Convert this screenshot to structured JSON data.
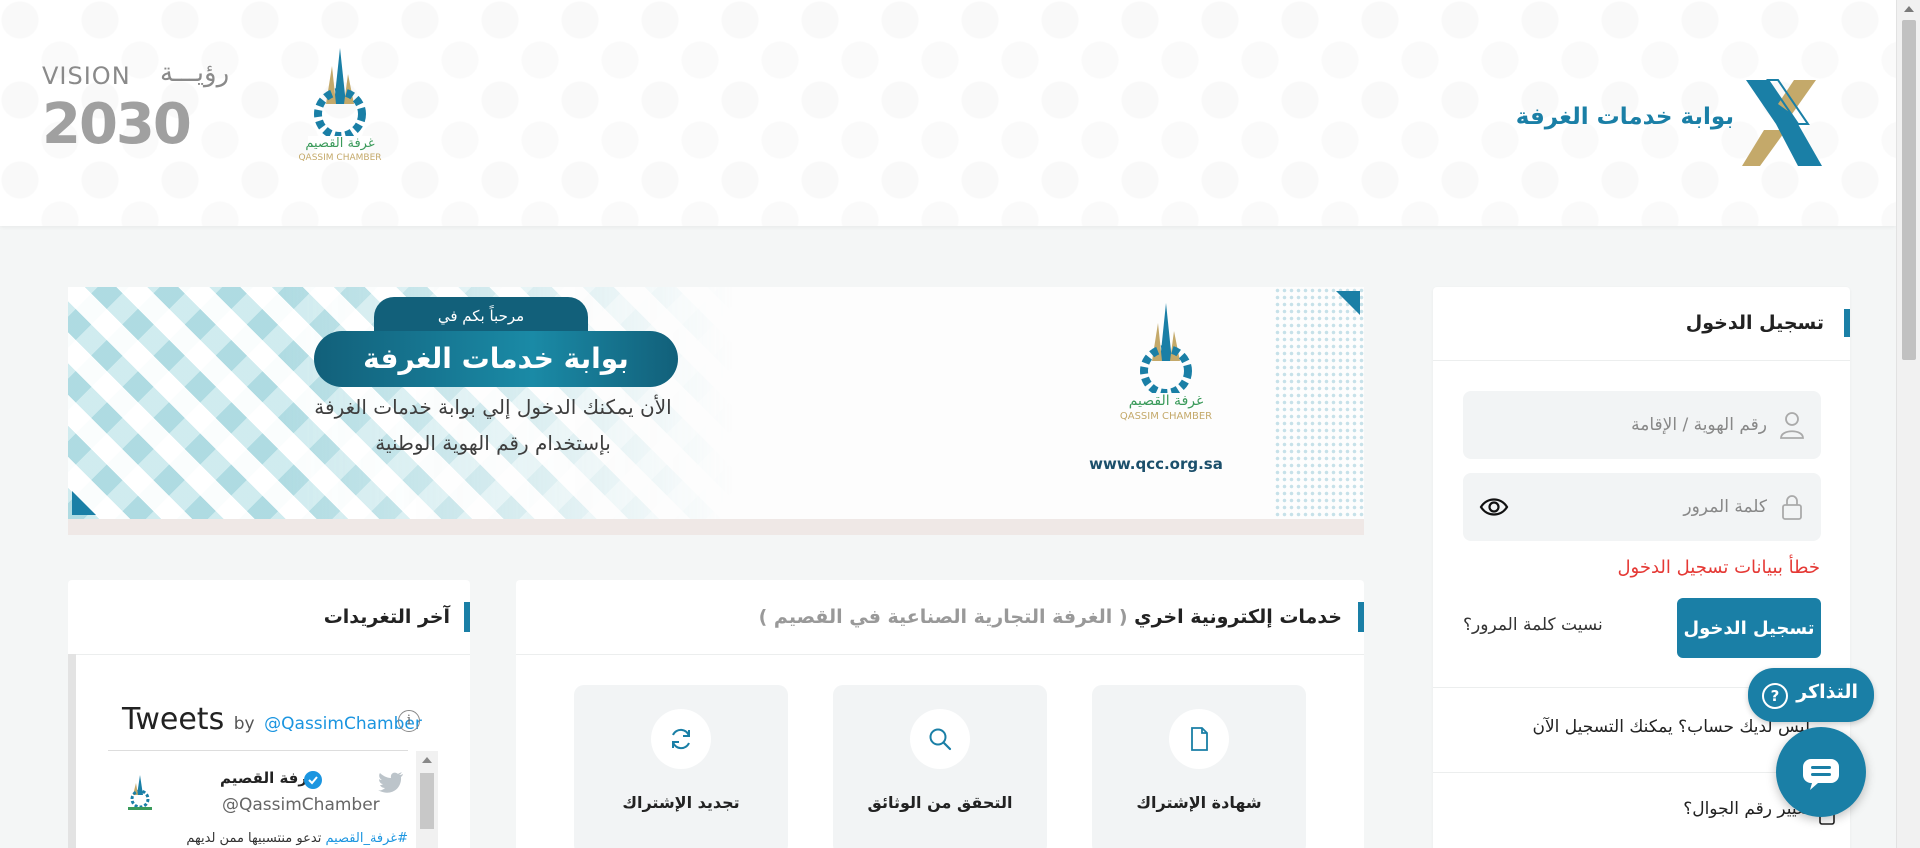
{
  "header": {
    "portal_title": "بوابة خدمات الغرفة",
    "vision_word": "VISION",
    "vision_ar": "رؤيـــة",
    "vision_year": "2030",
    "brand_color": "#1a7fa6"
  },
  "banner": {
    "welcome": "مرحباً بكم في",
    "portal_name": "بوابة خدمات الغرفة",
    "line1": "الأن يمكنك الدخول إلي بوابة خدمات الغرفة",
    "line2": "بإستخدام رقم الهوية الوطنية",
    "url": "www.qcc.org.sa"
  },
  "login": {
    "title": "تسجيل الدخول",
    "id_placeholder": "رقم الهوية / الإقامة",
    "password_placeholder": "كلمة المرور",
    "error": "خطأ ببيانات تسجيل الدخول",
    "submit_label": "تسجيل الدخول",
    "forgot_label": "نسيت كلمة المرور؟",
    "register_label": "ليس لديك حساب؟ يمكنك التسجيل الآن",
    "change_mobile_label": "تغيير رقم الجوال؟"
  },
  "floating": {
    "tickets_label": "التذاكر",
    "tickets_icon": "?"
  },
  "services": {
    "title": "خدمات إلكترونية اخري",
    "subtitle": "( الغرفة التجارية الصناعية في القصيم )",
    "tiles": [
      {
        "label": "شهادة الإشتراك",
        "icon": "document-icon"
      },
      {
        "label": "التحقق من الوثائق",
        "icon": "search-icon"
      },
      {
        "label": "تجديد الإشتراك",
        "icon": "refresh-icon"
      }
    ]
  },
  "tweets": {
    "title": "آخر التغريدات",
    "heading": "Tweets",
    "by": "by",
    "handle": "@QassimChamber",
    "info_icon": "i",
    "tweet": {
      "name": "غرفة القصيم",
      "username": "@QassimChamber",
      "hashtag": "#غرفة_القصيم",
      "text": " تدعو منتسبيها ممن لديهم"
    }
  }
}
